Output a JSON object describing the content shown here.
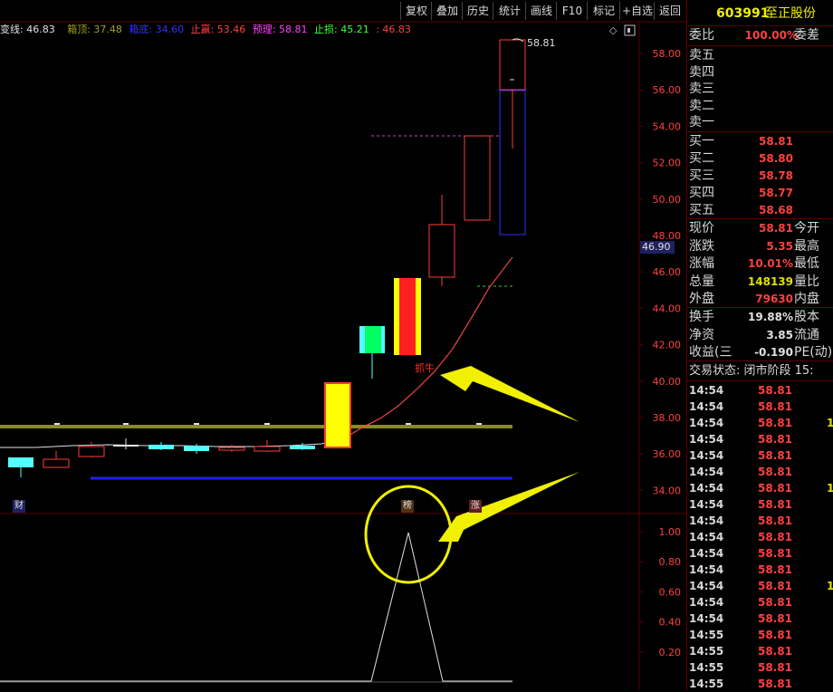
{
  "toolbar": {
    "buttons": [
      "复权",
      "叠加",
      "历史",
      "统计",
      "画线",
      "F10",
      "标记",
      "+自选",
      "返回"
    ]
  },
  "indicator_line": {
    "label": "变线: 46.83",
    "box_top": "箱顶: 37.48",
    "box_bottom": "箱底: 34.60",
    "take_profit": "止赢: 53.46",
    "expected": "预理: 58.81",
    "stop_loss": "止损: 45.21",
    "extra": ": 46.83"
  },
  "chart": {
    "price_axis_labels": [
      "58.00",
      "56.00",
      "54.00",
      "52.00",
      "50.00",
      "48.00",
      "46.00",
      "44.00",
      "42.00",
      "40.00",
      "38.00",
      "36.00",
      "34.00"
    ],
    "current_price_tag": "46.90",
    "high_label": "58.81",
    "annotation": "抓牛",
    "tags": {
      "cai": "财",
      "bang": "榜",
      "zhang": "涨"
    },
    "lower_axis_labels": [
      "1.00",
      "0.80",
      "0.60",
      "0.40",
      "0.20"
    ],
    "colors": {
      "up": "#ff3b3b",
      "down": "#54ffff",
      "box_top": "#a0a020",
      "box_bottom": "#2020ff",
      "arrow": "#f0f000"
    }
  },
  "panel": {
    "stock_code": "603991",
    "stock_name": "至正股份",
    "weibi": {
      "label": "委比",
      "value": "100.00%",
      "label2": "委差"
    },
    "sell": [
      {
        "label": "卖五",
        "price": ""
      },
      {
        "label": "卖四",
        "price": ""
      },
      {
        "label": "卖三",
        "price": ""
      },
      {
        "label": "卖二",
        "price": ""
      },
      {
        "label": "卖一",
        "price": ""
      }
    ],
    "buy": [
      {
        "label": "买一",
        "price": "58.81"
      },
      {
        "label": "买二",
        "price": "58.80"
      },
      {
        "label": "买三",
        "price": "58.78"
      },
      {
        "label": "买四",
        "price": "58.77"
      },
      {
        "label": "买五",
        "price": "58.68"
      }
    ],
    "stats": [
      {
        "label": "现价",
        "value": "58.81",
        "label2": "今开",
        "color": "#ff4040"
      },
      {
        "label": "涨跌",
        "value": "5.35",
        "label2": "最高",
        "color": "#ff4040"
      },
      {
        "label": "涨幅",
        "value": "10.01%",
        "label2": "最低",
        "color": "#ff4040"
      },
      {
        "label": "总量",
        "value": "148139",
        "label2": "量比",
        "color": "#e0e000"
      },
      {
        "label": "外盘",
        "value": "79630",
        "label2": "内盘",
        "color": "#ff4040"
      }
    ],
    "stats2": [
      {
        "label": "换手",
        "value": "19.88%",
        "label2": "股本",
        "color": "#e0e0e0"
      },
      {
        "label": "净资",
        "value": "3.85",
        "label2": "流通",
        "color": "#e0e0e0"
      },
      {
        "label": "收益(三",
        "value": "-0.190",
        "label2": "PE(动)",
        "color": "#e0e0e0"
      }
    ],
    "trade_status": "交易状态: 闭市阶段 15:",
    "ticks": [
      {
        "time": "14:54",
        "price": "58.81",
        "vol": ""
      },
      {
        "time": "14:54",
        "price": "58.81",
        "vol": ""
      },
      {
        "time": "14:54",
        "price": "58.81",
        "vol": "1"
      },
      {
        "time": "14:54",
        "price": "58.81",
        "vol": ""
      },
      {
        "time": "14:54",
        "price": "58.81",
        "vol": ""
      },
      {
        "time": "14:54",
        "price": "58.81",
        "vol": ""
      },
      {
        "time": "14:54",
        "price": "58.81",
        "vol": "1"
      },
      {
        "time": "14:54",
        "price": "58.81",
        "vol": ""
      },
      {
        "time": "14:54",
        "price": "58.81",
        "vol": ""
      },
      {
        "time": "14:54",
        "price": "58.81",
        "vol": ""
      },
      {
        "time": "14:54",
        "price": "58.81",
        "vol": ""
      },
      {
        "time": "14:54",
        "price": "58.81",
        "vol": ""
      },
      {
        "time": "14:54",
        "price": "58.81",
        "vol": "1"
      },
      {
        "time": "14:54",
        "price": "58.81",
        "vol": ""
      },
      {
        "time": "14:54",
        "price": "58.81",
        "vol": ""
      },
      {
        "time": "14:55",
        "price": "58.81",
        "vol": ""
      },
      {
        "time": "14:55",
        "price": "58.81",
        "vol": ""
      },
      {
        "time": "14:55",
        "price": "58.81",
        "vol": ""
      },
      {
        "time": "14:55",
        "price": "58.81",
        "vol": ""
      }
    ]
  }
}
